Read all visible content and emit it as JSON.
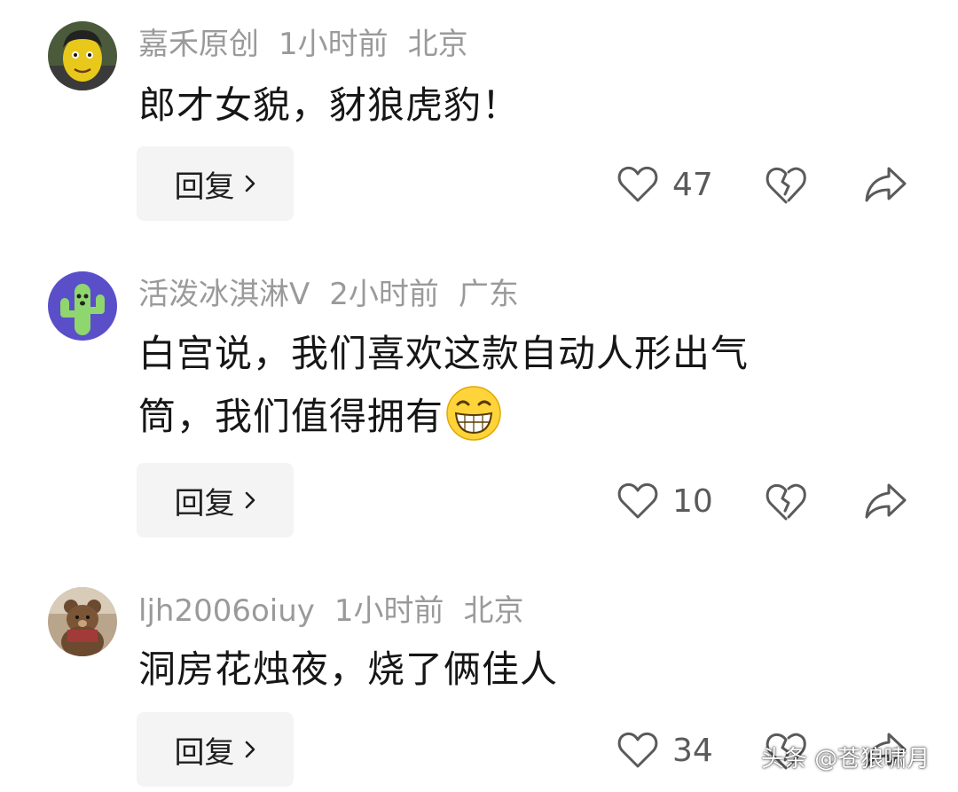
{
  "comments": [
    {
      "username": "嘉禾原创",
      "time": "1小时前",
      "location": "北京",
      "text": "郎才女貌，豺狼虎豹！",
      "reply_label": "回复",
      "like_count": "47",
      "avatar": "cartoon-man-avatar"
    },
    {
      "username": "活泼冰淇淋V",
      "time": "2小时前",
      "location": "广东",
      "text_line1": "白宫说，我们喜欢这款自动人形出气",
      "text_line2": "筒，我们值得拥有",
      "emoji": "grinning-face-emoji",
      "reply_label": "回复",
      "like_count": "10",
      "avatar": "cactus-avatar"
    },
    {
      "username": "ljh2006oiuy",
      "time": "1小时前",
      "location": "北京",
      "text": "洞房花烛夜，烧了俩佳人",
      "reply_label": "回复",
      "like_count": "34",
      "avatar": "teddy-bear-avatar"
    }
  ],
  "watermark": "头条 @苍狼啸月",
  "colors": {
    "meta_text": "#9a9a9a",
    "body_text": "#161616",
    "reply_bg": "#f4f4f4",
    "icon_stroke": "#5a5a5a"
  }
}
